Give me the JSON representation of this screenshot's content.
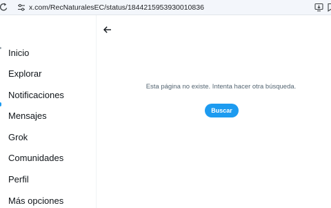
{
  "browser": {
    "url": "x.com/RecNaturalesEC/status/1844215953930010836"
  },
  "sidebar": {
    "items": [
      {
        "label": "Inicio"
      },
      {
        "label": "Explorar"
      },
      {
        "label": "Notificaciones"
      },
      {
        "label": "Mensajes"
      },
      {
        "label": "Grok"
      },
      {
        "label": "Comunidades"
      },
      {
        "label": "Perfil"
      },
      {
        "label": "Más opciones"
      }
    ]
  },
  "main": {
    "empty_message": "Esta página no existe. Intenta hacer otra búsqueda.",
    "search_button_label": "Buscar"
  },
  "colors": {
    "accent": "#1d9bf0",
    "text_primary": "#0f1419",
    "text_secondary": "#536471"
  },
  "icons": {
    "reload": "reload-icon",
    "site_settings": "tune-icon",
    "install": "install-icon",
    "bookmark": "bookmark-icon",
    "back": "arrow-left-icon"
  }
}
